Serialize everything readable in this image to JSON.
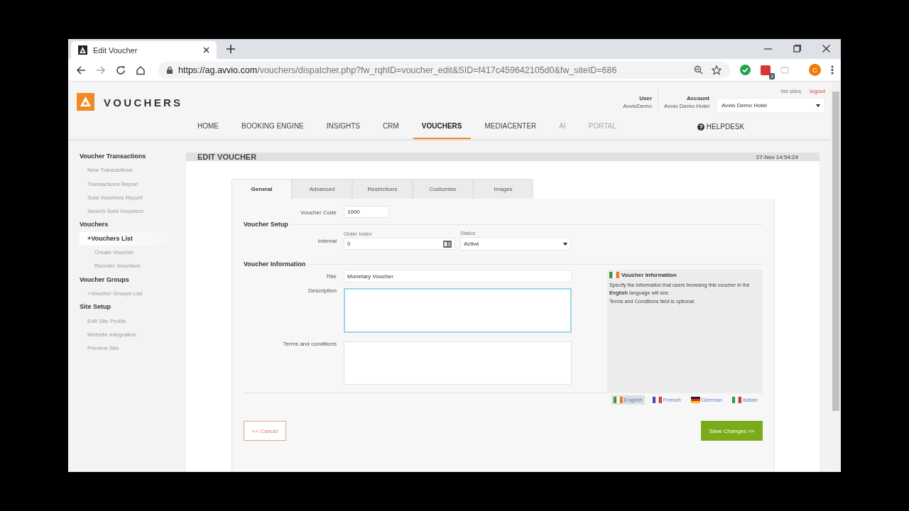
{
  "browser": {
    "tab_title": "Edit Voucher",
    "url_host": "https://ag.avvio.com",
    "url_path": "/vouchers/dispatcher.php?fw_rqhID=voucher_edit&SID=f417c459642105d0&fw_siteID=686",
    "extension_badge": "3",
    "profile_initial": "C"
  },
  "header": {
    "brand": "VOUCHERS",
    "user_label": "User",
    "user_value": "AvvioDemo",
    "account_label": "Account",
    "account_value": "Avvio Demo Hotel",
    "site_select": "Avvio Demo Hotel",
    "list_sites": "list sites",
    "logout": "logout"
  },
  "nav": [
    {
      "label": "HOME",
      "selected": false,
      "disabled": false
    },
    {
      "label": "BOOKING ENGINE",
      "selected": false,
      "disabled": false
    },
    {
      "label": "INSIGHTS",
      "selected": false,
      "disabled": false
    },
    {
      "label": "CRM",
      "selected": false,
      "disabled": false
    },
    {
      "label": "VOUCHERS",
      "selected": true,
      "disabled": false
    },
    {
      "label": "MEDIACENTER",
      "selected": false,
      "disabled": false
    },
    {
      "label": "AI",
      "selected": false,
      "disabled": true
    },
    {
      "label": "PORTAL",
      "selected": false,
      "disabled": true
    }
  ],
  "helpdesk": "HELPDESK",
  "sidebar": [
    {
      "title": "Voucher Transactions",
      "items": [
        {
          "label": "New Transactions",
          "selected": false
        },
        {
          "label": "Transactions Report",
          "selected": false
        },
        {
          "label": "Sold Vouchers Report",
          "selected": false
        },
        {
          "label": "Search Sold Vouchers",
          "selected": false
        }
      ]
    },
    {
      "title": "Vouchers",
      "items": [
        {
          "label": "+Vouchers List",
          "selected": true,
          "children": [
            {
              "label": "Create Voucher",
              "selected": false
            },
            {
              "label": "Reorder Vouchers",
              "selected": false
            }
          ]
        }
      ]
    },
    {
      "title": "Voucher Groups",
      "items": [
        {
          "label": "+Voucher Groups List",
          "selected": false
        }
      ]
    },
    {
      "title": "Site Setup",
      "items": [
        {
          "label": "Edit Site Profile",
          "selected": false
        },
        {
          "label": "Website Integration",
          "selected": false
        },
        {
          "label": "Preview Site",
          "selected": false
        }
      ]
    }
  ],
  "page": {
    "title": "EDIT VOUCHER",
    "timestamp": "27-Nov 14:54:24"
  },
  "tabs": [
    {
      "label": "General",
      "selected": true
    },
    {
      "label": "Advanced",
      "selected": false
    },
    {
      "label": "Restrictions",
      "selected": false
    },
    {
      "label": "Customise",
      "selected": false
    },
    {
      "label": "Images",
      "selected": false
    }
  ],
  "form": {
    "voucher_code_label": "Voucher Code",
    "voucher_code": "1000",
    "setup_heading": "Voucher Setup",
    "internal_label": "Internal",
    "order_index_label": "Order Index",
    "order_index": "0",
    "status_label": "Status",
    "status": "Active",
    "info_heading": "Voucher Information",
    "title_label": "Title",
    "title": "Monetary Voucher",
    "description_label": "Description",
    "description_focused": true,
    "terms_label": "Terms and conditions",
    "info_box_title": "Voucher Information",
    "info_box_text": "Specify the information that users browsing this voucher in the **English** language will see.",
    "info_box_note": "Terms and Conditions field is optional."
  },
  "languages": [
    {
      "label": "English",
      "selected": true,
      "kind": "ireland"
    },
    {
      "label": "French",
      "selected": false,
      "kind": "france"
    },
    {
      "label": "German",
      "selected": false,
      "kind": "germany"
    },
    {
      "label": "Italian",
      "selected": false,
      "kind": "italy"
    }
  ],
  "buttons": {
    "cancel": "<< Cancel",
    "save": "Save Changes >>"
  }
}
